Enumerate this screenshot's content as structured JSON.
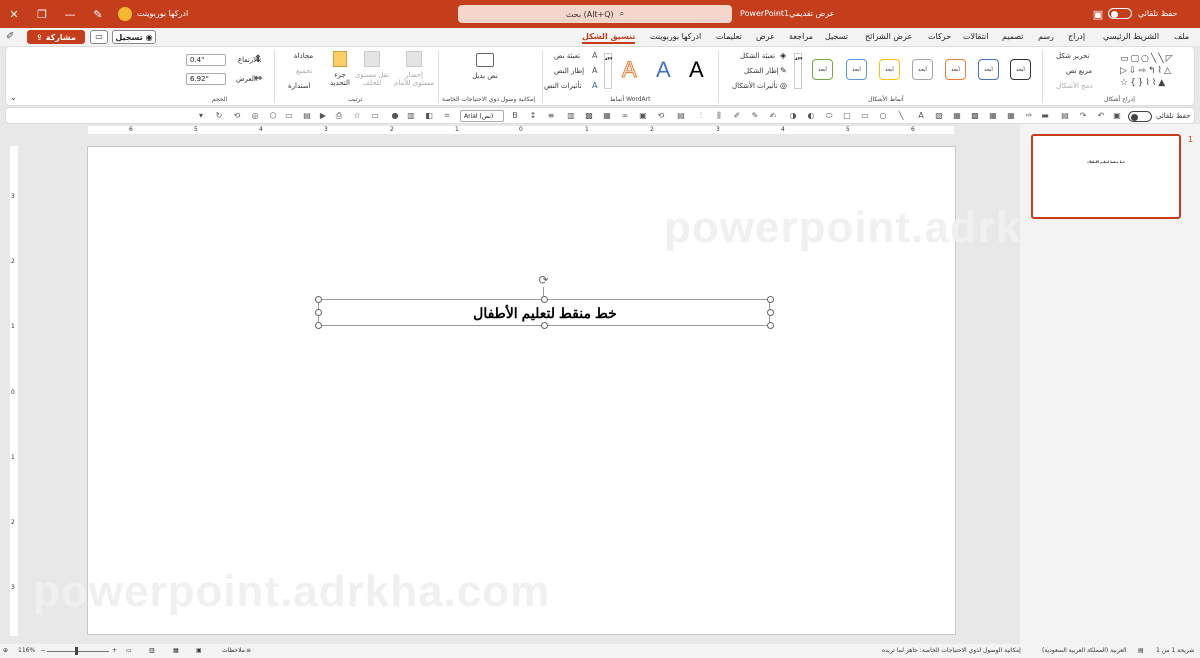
{
  "titlebar": {
    "autosave_label": "حفظ تلقائي",
    "doc_title": "عرض تقديمي1",
    "app_name": "PowerPoint",
    "search_placeholder": "بحث (Alt+Q)",
    "user_name": "ادركها بوربوينت",
    "accent": "#c43e1c"
  },
  "tabs": [
    "ملف",
    "الشريط الرئيسي",
    "إدراج",
    "رسم",
    "تصميم",
    "انتقالات",
    "حركات",
    "عرض الشرائح",
    "تسجيل",
    "مراجعة",
    "عرض",
    "تعليمات",
    "ادركها بوربوينت",
    "تنسيق الشكل"
  ],
  "active_tab": "تنسيق الشكل",
  "actions": {
    "record": "تسجيل",
    "share": "مشاركة"
  },
  "ribbon": {
    "insert_shapes": {
      "label": "إدراج أشكال",
      "edit_shape": "تحرير شكل",
      "text_box": "مربع نص",
      "merge_shapes": "دمج الأشكال"
    },
    "shape_styles": {
      "label": "أنماط الأشكال",
      "style_text": "أبجد",
      "fill": "تعبئة الشكل",
      "outline": "إطار الشكل",
      "effects": "تأثيرات الأشكال",
      "colors": [
        "#333333",
        "#4472c4",
        "#4472c4",
        "#a5a5a5",
        "#ed7d31",
        "#a5a5a5",
        "#ffc000",
        "#5b9bd5",
        "#70ad47"
      ]
    },
    "wordart": {
      "label": "أنماط WordArt",
      "letter": "A",
      "text_fill": "تعبئة نص",
      "text_outline": "إطار النص",
      "text_effects": "تأثيرات النص"
    },
    "accessibility": {
      "label": "إمكانية وصول ذوي الاحتياجات الخاصة",
      "alt_text": "نص بديل"
    },
    "arrange": {
      "label": "ترتيب",
      "bring_forward": "إحضار مستوى للأمام",
      "send_backward": "نقل مستوى للخلف",
      "selection_pane": "جزء التحديد",
      "align": "محاذاة",
      "group": "تجميع",
      "rotate": "استدارة"
    },
    "size": {
      "label": "الحجم",
      "height_label": "الارتفاع:",
      "height_value": "0.4\"",
      "width_label": "العرض:",
      "width_value": "6.92\""
    }
  },
  "qat": {
    "autosave_label": "حفظ تلقائي",
    "font_name": "Arial (نص)"
  },
  "ruler": {
    "h_ticks": [
      "6",
      "5",
      "4",
      "3",
      "2",
      "1",
      "0",
      "1",
      "2",
      "3",
      "4",
      "5",
      "6"
    ],
    "v_ticks": [
      "3",
      "2",
      "1",
      "0",
      "1",
      "2",
      "3"
    ]
  },
  "slide": {
    "title": "خط منقط لتعليم الأطفال",
    "watermark": "powerpoint.adrkha.com"
  },
  "thumbnails": [
    {
      "number": "1",
      "title": "خط منقط لتعليم الأطفال"
    }
  ],
  "status": {
    "slide_info": "شريحة 1 من 1",
    "language": "العربية (المملكة العربية السعودية)",
    "accessibility": "إمكانية الوصول لذوي الاحتياجات الخاصة: جاهز لما تريده",
    "notes": "ملاحظات",
    "zoom": "116%"
  }
}
